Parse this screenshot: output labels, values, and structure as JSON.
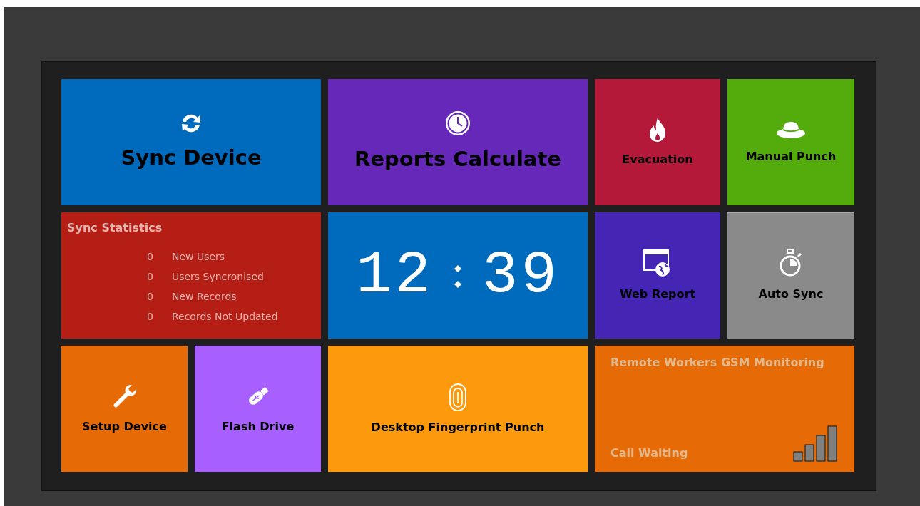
{
  "tiles": [
    {
      "kind": "action",
      "label": "Sync Device",
      "color": "#006bbd",
      "focused": false
    },
    {
      "kind": "action",
      "label": "Reports Calculate",
      "color": "#6628b8",
      "focused": false
    },
    {
      "kind": "action",
      "label": "Evacuation",
      "color": "#b4193a",
      "focused": false
    },
    {
      "kind": "action",
      "label": "Manual Punch",
      "color": "#54ac0c",
      "focused": false
    },
    {
      "kind": "stats",
      "title": "Sync Statistics",
      "color": "#b51e14",
      "rows": [
        {
          "count": "0",
          "label": "New Users"
        },
        {
          "count": "0",
          "label": "Users Syncronised"
        },
        {
          "count": "0",
          "label": "New Records"
        },
        {
          "count": "0",
          "label": "Records Not Updated"
        }
      ]
    },
    {
      "kind": "clock",
      "hours": "12",
      "minutes": "39",
      "color": "#006bbd"
    },
    {
      "kind": "action",
      "label": "Web Report",
      "color": "#4525b3",
      "focused": false
    },
    {
      "kind": "action",
      "label": "Auto Sync",
      "color": "#8a8a8a",
      "focused": true
    },
    {
      "kind": "action",
      "label": "Setup Device",
      "color": "#e66b06",
      "focused": false
    },
    {
      "kind": "action",
      "label": "Flash Drive",
      "color": "#a75ffd",
      "focused": false
    },
    {
      "kind": "action",
      "label": "Desktop Fingerprint Punch",
      "color": "#fd990c",
      "focused": false
    },
    {
      "kind": "gsm",
      "title": "Remote Workers GSM Monitoring",
      "status": "Call Waiting",
      "color": "#e66b06"
    }
  ]
}
